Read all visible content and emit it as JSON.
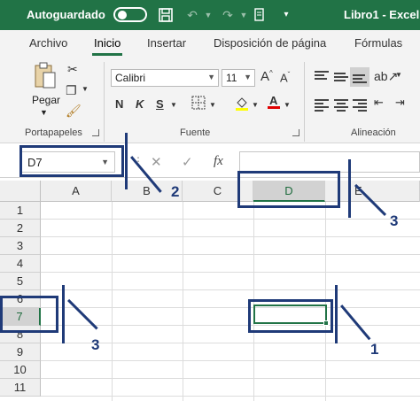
{
  "titlebar": {
    "autosave_label": "Autoguardado",
    "doc_title": "Libro1 - Excel",
    "icons": [
      "save-icon",
      "undo-icon",
      "redo-icon",
      "touch-mode-icon",
      "customize-qat-icon"
    ]
  },
  "tabs": [
    {
      "label": "Archivo"
    },
    {
      "label": "Inicio",
      "active": true
    },
    {
      "label": "Insertar"
    },
    {
      "label": "Disposición de página"
    },
    {
      "label": "Fórmulas"
    }
  ],
  "ribbon": {
    "clipboard": {
      "paste_label": "Pegar",
      "group_label": "Portapapeles"
    },
    "font": {
      "font_name": "Calibri",
      "font_size": "11",
      "group_label": "Fuente",
      "bold": "N",
      "italic": "K",
      "underline": "S"
    },
    "alignment": {
      "group_label": "Alineación"
    }
  },
  "formula_bar": {
    "name_box": "D7",
    "cancel_glyph": "✕",
    "enter_glyph": "✓",
    "fx_label": "fx",
    "formula_value": ""
  },
  "grid": {
    "columns": [
      "A",
      "B",
      "C",
      "D",
      "E"
    ],
    "rows": [
      "1",
      "2",
      "3",
      "4",
      "5",
      "6",
      "7",
      "8",
      "9",
      "10",
      "11"
    ],
    "selected_column": "D",
    "selected_row": "7"
  },
  "annotations": {
    "label_1": "1",
    "label_2": "2",
    "label_3a": "3",
    "label_3b": "3"
  },
  "colors": {
    "brand": "#217346",
    "annotation": "#1f3a78"
  }
}
